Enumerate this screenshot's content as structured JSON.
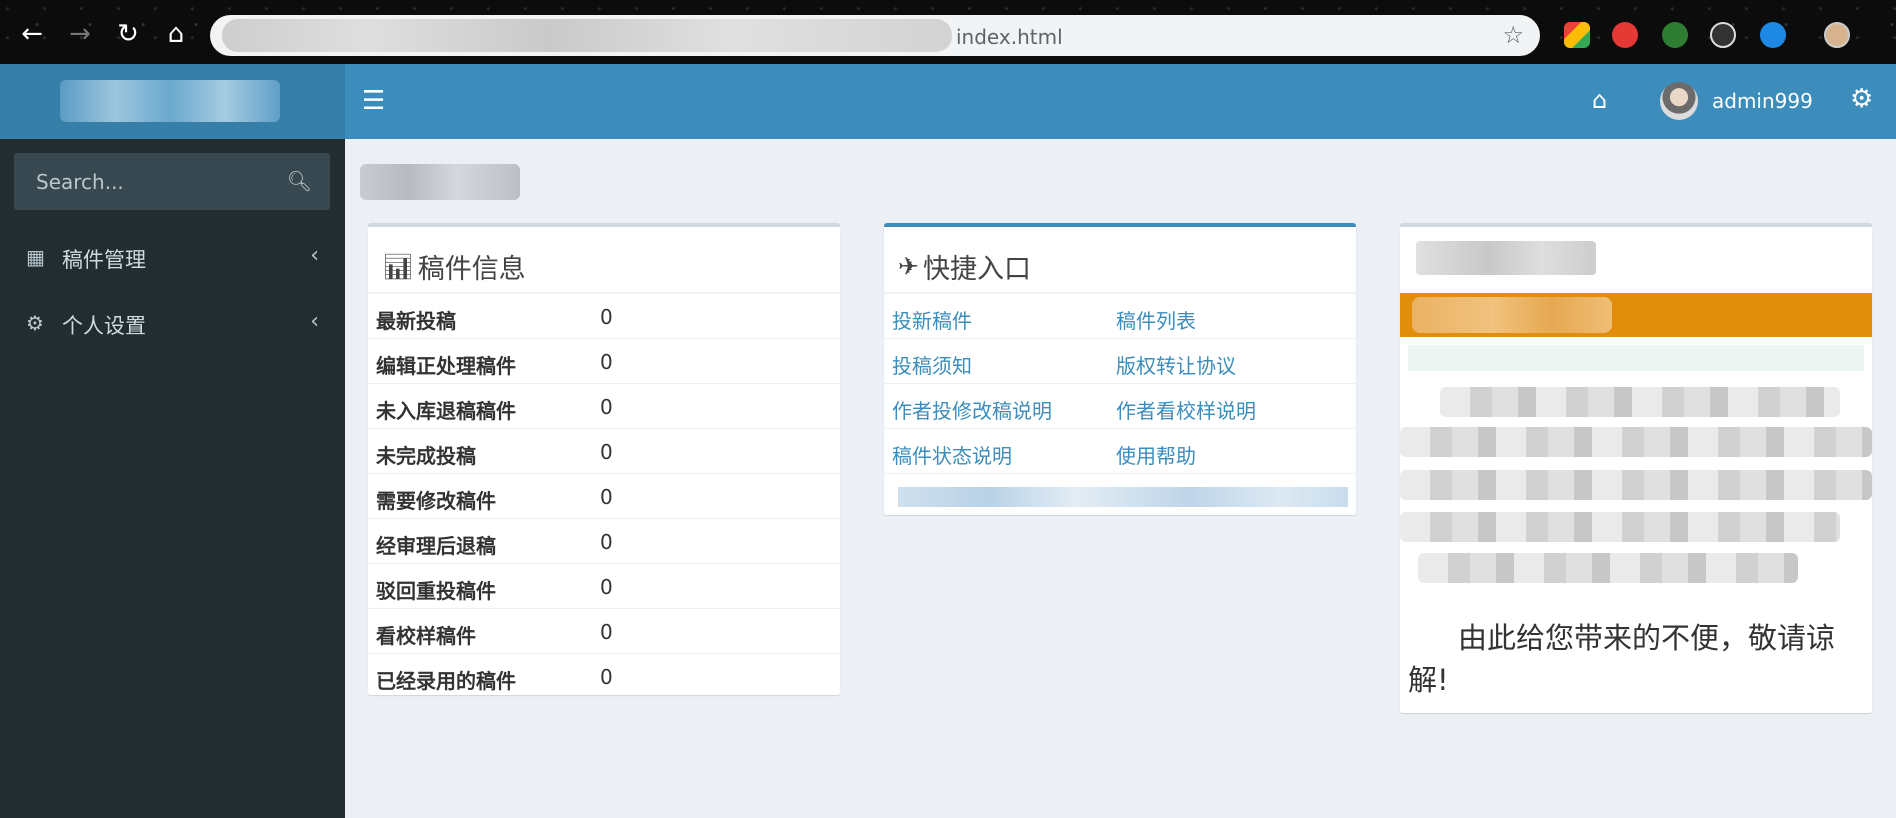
{
  "browser": {
    "url_visible_suffix": "index.html",
    "back_icon": "arrow-left-icon",
    "forward_icon": "arrow-right-icon",
    "reload_icon": "reload-icon",
    "home_icon": "home-icon",
    "star_icon": "star-icon"
  },
  "header": {
    "toggle_icon": "hamburger-icon",
    "home_icon": "home-icon",
    "username": "admin999",
    "settings_icon": "gears-icon"
  },
  "sidebar": {
    "search_placeholder": "Search...",
    "items": [
      {
        "label": "稿件管理",
        "icon": "grid-icon"
      },
      {
        "label": "个人设置",
        "icon": "gear-icon"
      }
    ]
  },
  "manuscript_info": {
    "title": "稿件信息",
    "rows": [
      {
        "label": "最新投稿",
        "value": "0"
      },
      {
        "label": "编辑正处理稿件",
        "value": "0"
      },
      {
        "label": "未入库退稿稿件",
        "value": "0"
      },
      {
        "label": "未完成投稿",
        "value": "0"
      },
      {
        "label": "需要修改稿件",
        "value": "0"
      },
      {
        "label": "经审理后退稿",
        "value": "0"
      },
      {
        "label": "驳回重投稿件",
        "value": "0"
      },
      {
        "label": "看校样稿件",
        "value": "0"
      },
      {
        "label": "已经录用的稿件",
        "value": "0"
      }
    ]
  },
  "quick_links": {
    "title": "快捷入口",
    "links": [
      [
        "投新稿件",
        "稿件列表"
      ],
      [
        "投稿须知",
        "版权转让协议"
      ],
      [
        "作者投修改稿说明",
        "作者看校样说明"
      ],
      [
        "稿件状态说明",
        "使用帮助"
      ]
    ]
  },
  "notice": {
    "closing_text": "由此给您带来的不便，敬请谅解!"
  },
  "colors": {
    "header": "#3c8dbc",
    "logo": "#367fa9",
    "sidebar": "#222d32",
    "content_bg": "#ecf0f5",
    "link": "#3c8dbc",
    "notice_bar": "#e08e0b"
  }
}
